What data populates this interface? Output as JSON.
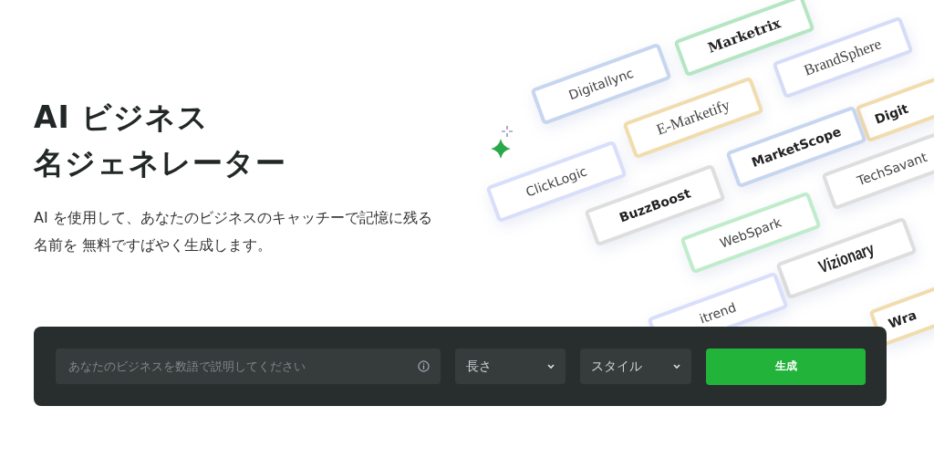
{
  "hero": {
    "title_lines": [
      "AI ビジネス",
      "名ジェネレーター"
    ],
    "description": "AI を使用して、あなたのビジネスのキャッチーで記憶に残る名前を 無料ですばやく生成します。"
  },
  "name_cards": [
    {
      "text": "Marketrix",
      "kind": "bold-serif",
      "color": "#b5e6c3"
    },
    {
      "text": "BrandSphere",
      "kind": "serif",
      "color": "#d6dcf7"
    },
    {
      "text": "Digitallync",
      "kind": "sans",
      "color": "#c7d6ef"
    },
    {
      "text": "E-Marketify",
      "kind": "serif",
      "color": "#f1dcae"
    },
    {
      "text": "Digit",
      "kind": "heavy",
      "color": "#f1dcae"
    },
    {
      "text": "ClickLogic",
      "kind": "sans",
      "color": "#d9defa"
    },
    {
      "text": "MarketScope",
      "kind": "heavy",
      "color": "#c7d6ef"
    },
    {
      "text": "TechSavant",
      "kind": "sans",
      "color": "#dedede"
    },
    {
      "text": "BuzzBoost",
      "kind": "heavy",
      "color": "#dedede"
    },
    {
      "text": "WebSpark",
      "kind": "sans",
      "color": "#bfeccb"
    },
    {
      "text": "Vizionary",
      "kind": "condensed",
      "color": "#dedede"
    },
    {
      "text": "itrend",
      "kind": "sans",
      "color": "#d9defa"
    },
    {
      "text": "Wra",
      "kind": "heavy",
      "color": "#f1dcae"
    }
  ],
  "generator": {
    "input": {
      "placeholder": "あなたのビジネスを数語で説明してください"
    },
    "selects": [
      {
        "label": "長さ"
      },
      {
        "label": "スタイル"
      }
    ],
    "button": "生成"
  }
}
